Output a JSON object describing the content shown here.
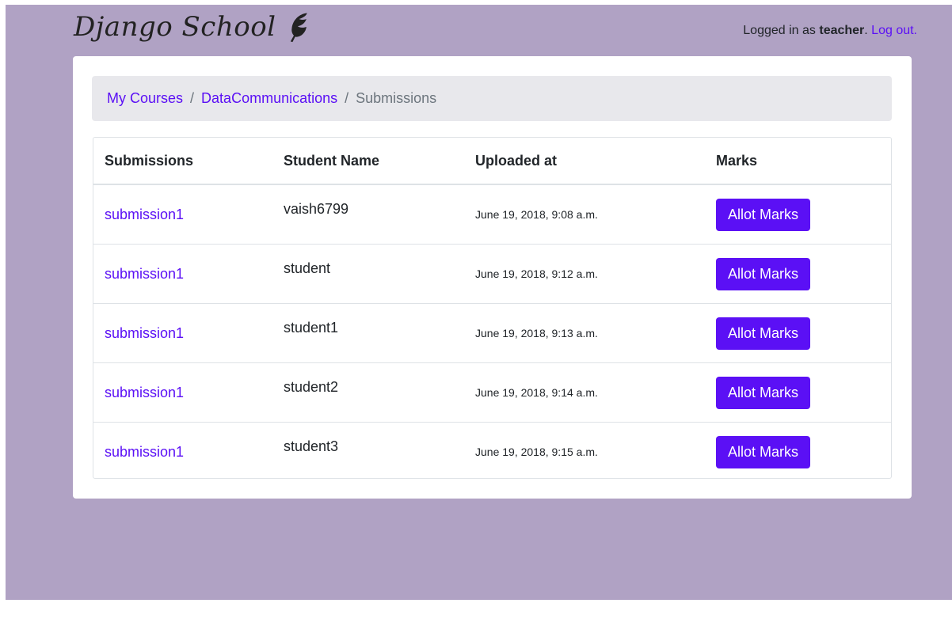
{
  "brand": {
    "title": "Django School"
  },
  "auth": {
    "prefix": "Logged in as ",
    "username": "teacher",
    "suffix": ". ",
    "logout": "Log out."
  },
  "breadcrumb": {
    "items": [
      "My Courses",
      "DataCommunications",
      "Submissions"
    ],
    "separator": "/"
  },
  "table": {
    "headers": [
      "Submissions",
      "Student Name",
      "Uploaded at",
      "Marks"
    ],
    "rows": [
      {
        "submission": "submission1",
        "student": "vaish6799",
        "uploaded": "June 19, 2018, 9:08 a.m.",
        "action": "Allot Marks"
      },
      {
        "submission": "submission1",
        "student": "student",
        "uploaded": "June 19, 2018, 9:12 a.m.",
        "action": "Allot Marks"
      },
      {
        "submission": "submission1",
        "student": "student1",
        "uploaded": "June 19, 2018, 9:13 a.m.",
        "action": "Allot Marks"
      },
      {
        "submission": "submission1",
        "student": "student2",
        "uploaded": "June 19, 2018, 9:14 a.m.",
        "action": "Allot Marks"
      },
      {
        "submission": "submission1",
        "student": "student3",
        "uploaded": "June 19, 2018, 9:15 a.m.",
        "action": "Allot Marks"
      }
    ]
  },
  "colors": {
    "background": "#b0a2c4",
    "accent": "#5b10f5",
    "breadcrumb_bg": "#e8e8ec"
  },
  "icons": {
    "brand": "feather-icon"
  }
}
